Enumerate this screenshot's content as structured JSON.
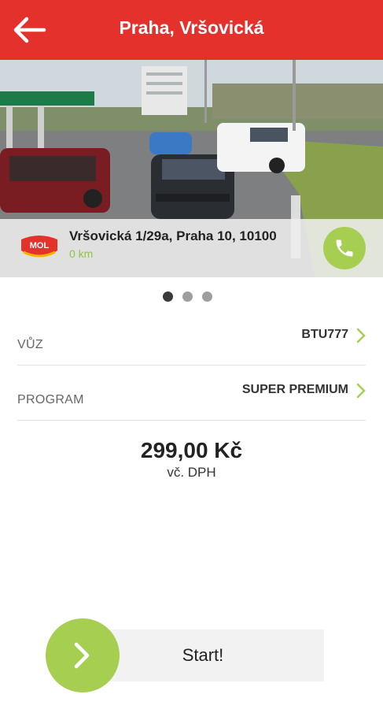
{
  "header": {
    "title": "Praha, Vršovická",
    "back_icon": "arrow-left-icon"
  },
  "station": {
    "address": "Vršovická 1/29a, Praha 10, 10100",
    "distance": "0 km",
    "logo_text": "MOL",
    "call_icon": "phone-icon"
  },
  "carousel": {
    "pages": 3,
    "active": 1
  },
  "vehicle": {
    "label": "VŮZ",
    "value": "BTU777"
  },
  "program": {
    "label": "PROGRAM",
    "value": "SUPER PREMIUM"
  },
  "price": {
    "amount": "299,00 Kč",
    "note": "vč. DPH"
  },
  "start": {
    "label": "Start!",
    "icon": "chevron-right-icon"
  },
  "colors": {
    "brand": "#e4312b",
    "accent": "#a6cf52",
    "distance": "#8cc63f"
  }
}
